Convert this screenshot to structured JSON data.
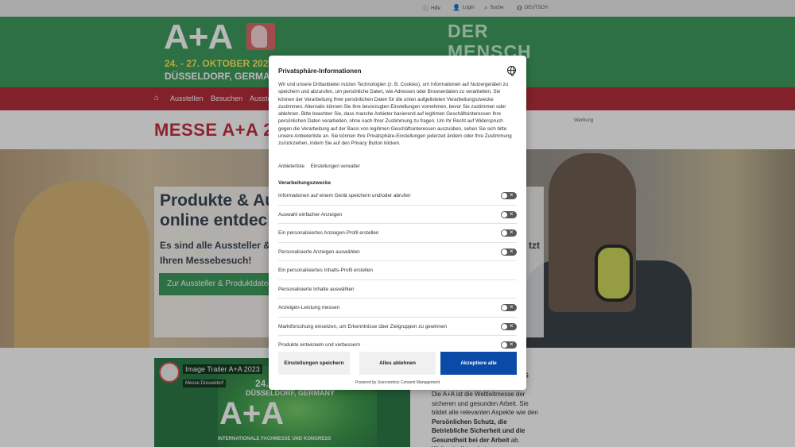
{
  "topbar": {
    "items": [
      {
        "label": "Hilfe",
        "icon": "info-icon"
      },
      {
        "label": "Login",
        "icon": "user-icon"
      },
      {
        "label": "Suche",
        "icon": "search-icon"
      },
      {
        "label": "DEUTSCH",
        "icon": "globe-icon"
      }
    ]
  },
  "banner": {
    "logo_text": "A+A",
    "date": "24. - 27. OKTOBER 2023",
    "city": "DÜSSELDORF, GERMANY",
    "slogan_line1": "DER",
    "slogan_line2": "MENSCH",
    "colors": {
      "green": "#3f9b5d",
      "red": "#b62e3b",
      "yellow": "#ffeb5c"
    }
  },
  "nav": {
    "items": [
      "Ausstellen",
      "Besuchen",
      "Ausstellen"
    ]
  },
  "page": {
    "title": "MESSE A+A 2023",
    "ad_label": "Werbung"
  },
  "hero": {
    "headline_1": "Produkte & Aussteller",
    "headline_2": "online entdecken",
    "sub_1": "Es sind alle Aussteller & Produkte",
    "sub_right": "tzt",
    "sub_2": "Ihren Messebesuch!",
    "cta": "Zur Aussteller & Produktdatenbank"
  },
  "video": {
    "title": "Image Trailer A+A 2023",
    "channel": "Messe Düsseldorf",
    "date": "24. - 27.",
    "city": "DÜSSELDORF, GERMANY",
    "logo": "A+A",
    "claim": "INTERNATIONALE FACHMESSE UND KONGRESS"
  },
  "sidebar": {
    "heading": "NG",
    "text_1": "Die A+A ist die Weltleitmesse der sicheren und gesunden Arbeit. Sie bildet alle relevanten Aspekte wie den",
    "text_bold": "Persönlichen Schutz, die Betriebliche Sicherheit und die Gesundheit bei der Arbeit",
    "text_2": "ab. Weltweit gibt es keine"
  },
  "consent": {
    "title": "Privatsphäre-Informationen",
    "body": "Wir und unsere Drittanbieter nutzen Technologien (z. B. Cookies), um Informationen auf Nutzergeräten zu speichern und abzurufen, um persönliche Daten, wie Adressen oder Browserdaten zu verarbeiten. Sie können der Verarbeitung Ihrer persönlichen Daten für die unten aufgelisteten Verarbeitungszwecke zustimmen. Alternativ können Sie Ihre bevorzugten Einstellungen vornehmen, bevor Sie zustimmen oder ablehnen. Bitte beachten Sie, dass manche Anbieter basierend auf legitimen Geschäftsinteressen Ihre persönlichen Daten verarbeiten, ohne nach Ihrer Zustimmung zu fragen. Um Ihr Recht auf Widerspruch gegen die Verarbeitung auf der Basis von legitimen Geschäftsinteressen auszuüben, sehen Sie sich bitte unsere Anbieterliste an. Sie können Ihre Privatsphäre-Einstellungen jederzeit ändern oder Ihre Zustimmung zurückziehen, indem Sie auf den Privacy Button klicken.",
    "link_vendors": "Anbieterliste",
    "link_settings": "Einstellungen verwalter",
    "section_title": "Verarbeitungszwecke",
    "purposes": [
      {
        "label": "Informationen auf einem Gerät speichern und/oder abrufen",
        "toggle": true
      },
      {
        "label": "Auswahl einfacher Anzeigen",
        "toggle": true
      },
      {
        "label": "Ein personalisiertes Anzeigen-Profil erstellen",
        "toggle": true
      },
      {
        "label": "Personalisierte Anzeigen auswählen",
        "toggle": true
      },
      {
        "label": "Ein personalisiertes Inhalts-Profil erstellen",
        "toggle": false
      },
      {
        "label": "Personalisierte Inhalte auswählen",
        "toggle": false
      },
      {
        "label": "Anzeigen-Leistung messen",
        "toggle": true
      },
      {
        "label": "Marktforschung einsetzen, um Erkenntnisse über Zielgruppen zu gewinnen",
        "toggle": true
      },
      {
        "label": "Produkte entwickeln und verbessern",
        "toggle": true
      }
    ],
    "btn_settings": "Einstellungen speichern",
    "btn_deny": "Alles ablehnen",
    "btn_accept": "Akzeptiere alle",
    "powered_by": "Powered by Usercentrics Consent Management",
    "accent_color": "#0b4aa7"
  }
}
